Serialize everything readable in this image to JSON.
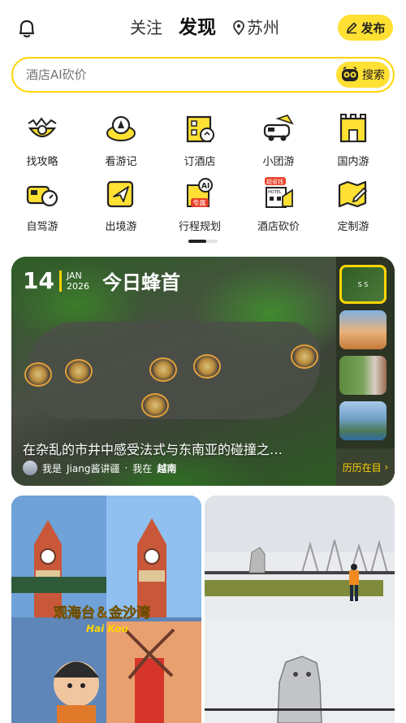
{
  "header": {
    "tabs": [
      {
        "label": "关注",
        "active": false
      },
      {
        "label": "发现",
        "active": true
      }
    ],
    "location": "苏州",
    "publish_label": "发布",
    "bell_icon": "bell-icon"
  },
  "search": {
    "placeholder": "酒店AI砍价",
    "button_label": "搜索"
  },
  "categories": [
    {
      "label": "找攻略",
      "icon": "guide-bowl-icon"
    },
    {
      "label": "看游记",
      "icon": "travelnote-icon"
    },
    {
      "label": "订酒店",
      "icon": "hotel-icon"
    },
    {
      "label": "小团游",
      "icon": "tour-bus-icon"
    },
    {
      "label": "国内游",
      "icon": "great-wall-icon"
    },
    {
      "label": "自驾游",
      "icon": "car-icon"
    },
    {
      "label": "出境游",
      "icon": "plane-icon"
    },
    {
      "label": "行程规划",
      "icon": "ai-planner-icon",
      "badge": "专属"
    },
    {
      "label": "酒店砍价",
      "icon": "hotel-bargain-icon",
      "badge": "超省钱"
    },
    {
      "label": "定制游",
      "icon": "custom-map-icon"
    }
  ],
  "featured": {
    "day": "14",
    "month": "JAN",
    "year": "2026",
    "name": "今日蜂首",
    "title": "在杂乱的市井中感受法式与东南亚的碰撞之…",
    "author_prefix": "我是",
    "author": "Jiang酱讲疆",
    "location_prefix": "我在",
    "location": "越南",
    "more_label": "历历在目",
    "thumb_caption": "S S"
  },
  "feed": {
    "left": {
      "caption": "观海台＆金沙湾",
      "subcaption": "Hai Kou"
    },
    "right": {}
  },
  "colors": {
    "accent": "#ffd400",
    "accent_light": "#ffe033"
  }
}
